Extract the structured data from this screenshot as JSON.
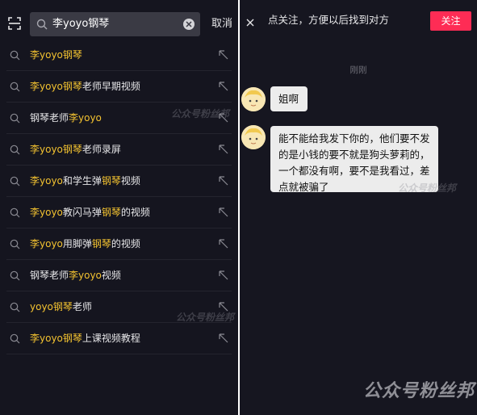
{
  "search": {
    "query": "李yoyo钢琴",
    "cancel_label": "取消"
  },
  "suggestions": [
    {
      "parts": [
        {
          "t": "李yoyo钢琴",
          "h": true
        }
      ]
    },
    {
      "parts": [
        {
          "t": "李yoyo钢琴",
          "h": true
        },
        {
          "t": "老师早期视频",
          "h": false
        }
      ]
    },
    {
      "parts": [
        {
          "t": "钢琴老师",
          "h": false
        },
        {
          "t": "李yoyo",
          "h": true
        }
      ]
    },
    {
      "parts": [
        {
          "t": "李yoyo钢琴",
          "h": true
        },
        {
          "t": "老师录屏",
          "h": false
        }
      ]
    },
    {
      "parts": [
        {
          "t": "李yoyo",
          "h": true
        },
        {
          "t": "和学生弹",
          "h": false
        },
        {
          "t": "钢琴",
          "h": true
        },
        {
          "t": "视频",
          "h": false
        }
      ]
    },
    {
      "parts": [
        {
          "t": "李yoyo",
          "h": true
        },
        {
          "t": "教闪马弹",
          "h": false
        },
        {
          "t": "钢琴",
          "h": true
        },
        {
          "t": "的视频",
          "h": false
        }
      ]
    },
    {
      "parts": [
        {
          "t": "李yoyo",
          "h": true
        },
        {
          "t": "用脚弹",
          "h": false
        },
        {
          "t": "钢琴",
          "h": true
        },
        {
          "t": "的视频",
          "h": false
        }
      ]
    },
    {
      "parts": [
        {
          "t": "钢琴老师",
          "h": false
        },
        {
          "t": "李yoyo",
          "h": true
        },
        {
          "t": "视频",
          "h": false
        }
      ]
    },
    {
      "parts": [
        {
          "t": "yoyo钢琴",
          "h": true
        },
        {
          "t": "老师",
          "h": false
        }
      ]
    },
    {
      "parts": [
        {
          "t": "李yoyo钢琴",
          "h": true
        },
        {
          "t": "上课视频教程",
          "h": false
        }
      ]
    }
  ],
  "chat": {
    "prompt": "点关注，方便以后找到对方",
    "follow_label": "关注",
    "timestamp": "刚刚",
    "messages": [
      {
        "text": "姐啊"
      },
      {
        "text": "能不能给我发下你的，他们要不发的是小钱的要不就是狗头萝莉的，一个都没有啊，要不是我看过，差点就被骗了"
      }
    ]
  },
  "watermark": "公众号粉丝邦",
  "colors": {
    "highlight": "#f3c230",
    "follow_button": "#fe2c55",
    "left_background": "#15151f",
    "right_background": "#161620"
  },
  "icons": {
    "scan": "scan-icon",
    "search": "search-icon",
    "clear": "clear-icon",
    "suggestion": "search-icon",
    "fill": "arrow-up-left-icon",
    "close": "close-icon"
  }
}
